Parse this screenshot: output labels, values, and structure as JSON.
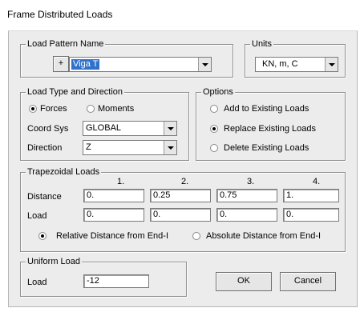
{
  "window": {
    "title": "Frame Distributed Loads"
  },
  "load_pattern": {
    "group_label": "Load Pattern Name",
    "add_button": "+",
    "selected": "Viga T"
  },
  "units": {
    "group_label": "Units",
    "selected": "KN, m, C"
  },
  "load_type": {
    "group_label": "Load Type and Direction",
    "forces": "Forces",
    "moments": "Moments",
    "selected": "Forces",
    "coord_sys_label": "Coord Sys",
    "coord_sys_value": "GLOBAL",
    "direction_label": "Direction",
    "direction_value": "Z"
  },
  "options": {
    "group_label": "Options",
    "add": "Add to Existing Loads",
    "replace": "Replace Existing Loads",
    "delete": "Delete Existing Loads",
    "selected": "Replace Existing Loads"
  },
  "trapezoidal": {
    "group_label": "Trapezoidal Loads",
    "columns": [
      "1.",
      "2.",
      "3.",
      "4."
    ],
    "distance_label": "Distance",
    "distances": [
      "0.",
      "0.25",
      "0.75",
      "1."
    ],
    "load_label": "Load",
    "loads": [
      "0.",
      "0.",
      "0.",
      "0."
    ],
    "relative": "Relative Distance from End-I",
    "absolute": "Absolute Distance from End-I",
    "selected": "Relative Distance from End-I"
  },
  "uniform": {
    "group_label": "Uniform Load",
    "load_label": "Load",
    "load_value": "-12"
  },
  "buttons": {
    "ok": "OK",
    "cancel": "Cancel"
  }
}
